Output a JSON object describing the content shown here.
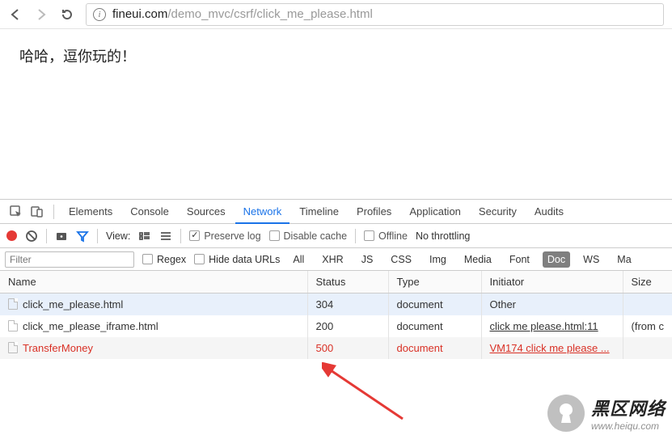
{
  "browser": {
    "url_domain": "fineui.com",
    "url_path": "/demo_mvc/csrf/click_me_please.html"
  },
  "page": {
    "body_text": "哈哈，逗你玩的！"
  },
  "devtools": {
    "tabs": {
      "elements": "Elements",
      "console": "Console",
      "sources": "Sources",
      "network": "Network",
      "timeline": "Timeline",
      "profiles": "Profiles",
      "application": "Application",
      "security": "Security",
      "audits": "Audits"
    },
    "toolbar": {
      "view_label": "View:",
      "preserve_log": "Preserve log",
      "disable_cache": "Disable cache",
      "offline": "Offline",
      "throttling": "No throttling"
    },
    "filterbar": {
      "filter_placeholder": "Filter",
      "regex": "Regex",
      "hide_data_urls": "Hide data URLs",
      "types": {
        "all": "All",
        "xhr": "XHR",
        "js": "JS",
        "css": "CSS",
        "img": "Img",
        "media": "Media",
        "font": "Font",
        "doc": "Doc",
        "ws": "WS",
        "ma": "Ma"
      }
    },
    "columns": {
      "name": "Name",
      "status": "Status",
      "type": "Type",
      "initiator": "Initiator",
      "size": "Size"
    },
    "requests": [
      {
        "name": "click_me_please.html",
        "status": "304",
        "type": "document",
        "initiator": "Other",
        "size": ""
      },
      {
        "name": "click_me_please_iframe.html",
        "status": "200",
        "type": "document",
        "initiator": "click me please.html:11",
        "size": "(from c"
      },
      {
        "name": "TransferMoney",
        "status": "500",
        "type": "document",
        "initiator": "VM174 click me please ...",
        "size": ""
      }
    ]
  },
  "watermark": {
    "title": "黑区网络",
    "subtitle": "www.heiqu.com"
  }
}
